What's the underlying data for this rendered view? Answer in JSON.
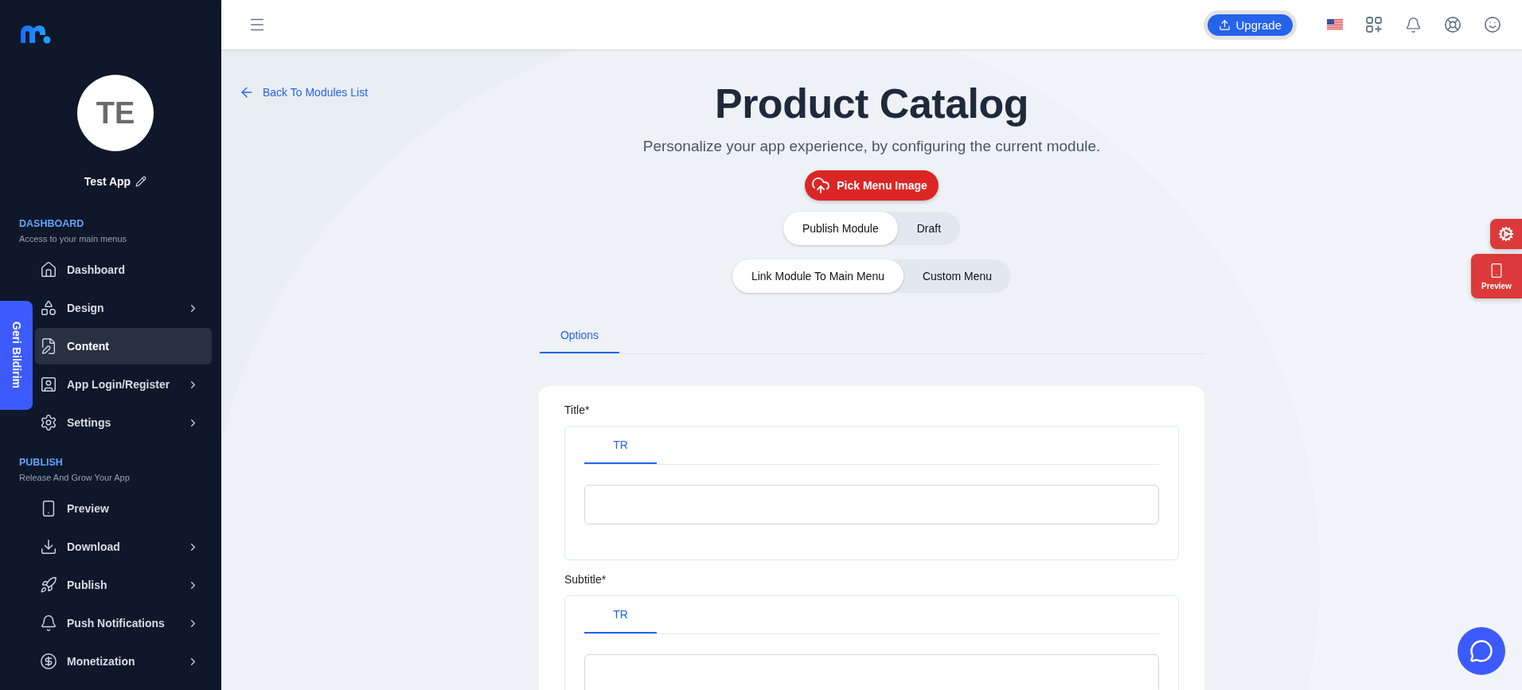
{
  "sidebar": {
    "avatar_initials": "TE",
    "app_name": "Test App",
    "sections": [
      {
        "title": "DASHBOARD",
        "subtitle": "Access to your main menus",
        "items": [
          {
            "label": "Dashboard",
            "has_submenu": false,
            "selected": false
          },
          {
            "label": "Design",
            "has_submenu": true,
            "selected": false
          },
          {
            "label": "Content",
            "has_submenu": false,
            "selected": true
          },
          {
            "label": "App Login/Register",
            "has_submenu": true,
            "selected": false
          },
          {
            "label": "Settings",
            "has_submenu": true,
            "selected": false
          }
        ]
      },
      {
        "title": "PUBLISH",
        "subtitle": "Release And Grow Your App",
        "items": [
          {
            "label": "Preview",
            "has_submenu": false,
            "selected": false
          },
          {
            "label": "Download",
            "has_submenu": true,
            "selected": false
          },
          {
            "label": "Publish",
            "has_submenu": true,
            "selected": false
          },
          {
            "label": "Push Notifications",
            "has_submenu": true,
            "selected": false
          },
          {
            "label": "Monetization",
            "has_submenu": true,
            "selected": false
          }
        ]
      }
    ]
  },
  "feedback_tab": {
    "label": "Geri Bildirim"
  },
  "topbar": {
    "upgrade_button": "Upgrade"
  },
  "page": {
    "back_link": "Back To Modules List",
    "title": "Product Catalog",
    "subtitle": "Personalize your app experience, by configuring the current module.",
    "pick_image_button": "Pick Menu Image",
    "toggles": [
      {
        "options": [
          {
            "label": "Publish Module",
            "selected": true
          },
          {
            "label": "Draft",
            "selected": false
          }
        ]
      },
      {
        "options": [
          {
            "label": "Link Module To Main Menu",
            "selected": true
          },
          {
            "label": "Custom Menu",
            "selected": false
          }
        ]
      }
    ],
    "tabs": [
      {
        "label": "Options",
        "selected": true
      }
    ],
    "fields": [
      {
        "label": "Title*",
        "languages": [
          {
            "label": "TR",
            "selected": true
          }
        ]
      },
      {
        "label": "Subtitle*",
        "languages": [
          {
            "label": "TR",
            "selected": true
          }
        ]
      }
    ]
  },
  "side_actions": {
    "preview_label": "Preview"
  }
}
